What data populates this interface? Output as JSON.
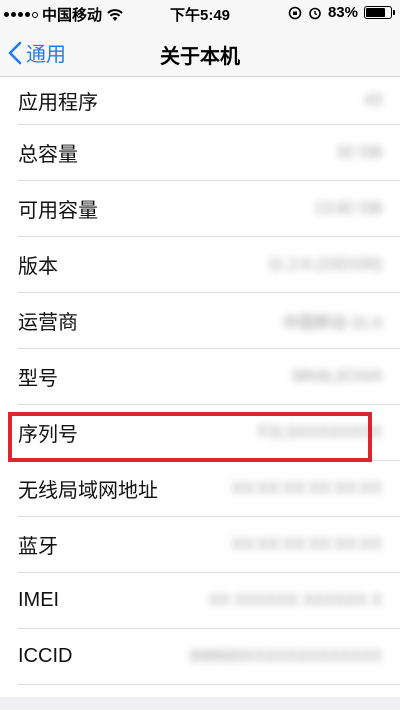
{
  "status_bar": {
    "carrier": "中国移动",
    "time": "下午5:49",
    "battery_percent": "83%",
    "battery_level": 0.83
  },
  "nav": {
    "back_label": "通用",
    "title": "关于本机"
  },
  "rows": [
    {
      "label": "应用程序",
      "value": "43"
    },
    {
      "label": "总容量",
      "value": "32 GB"
    },
    {
      "label": "可用容量",
      "value": "13.82 GB"
    },
    {
      "label": "版本",
      "value": "11.2.6 (15D100)"
    },
    {
      "label": "运营商",
      "value": "中国移动 31.0"
    },
    {
      "label": "型号",
      "value": "MN4L2CH/A"
    },
    {
      "label": "序列号",
      "value": "F2LSXXXXXXXX"
    },
    {
      "label": "无线局域网地址",
      "value": "XX:XX:XX:XX:XX:XX"
    },
    {
      "label": "蓝牙",
      "value": "XX:XX:XX:XX:XX:XX"
    },
    {
      "label": "IMEI",
      "value": "XX XXXXXX XXXXXX X"
    },
    {
      "label": "ICCID",
      "value": "898600XXXXXXXXXXXXX"
    }
  ],
  "colors": {
    "accent": "#1e7cf7",
    "highlight": "#d9262f"
  }
}
